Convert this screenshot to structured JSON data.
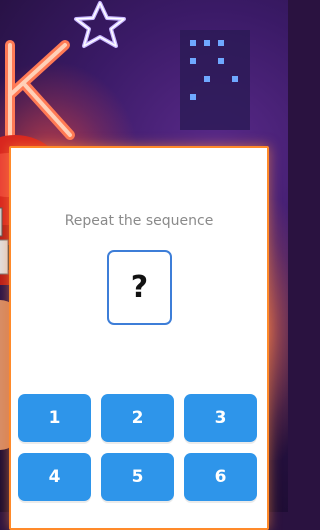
{
  "game": {
    "prompt": "Repeat the sequence",
    "sequence_display": "?",
    "keypad": [
      "1",
      "2",
      "3",
      "4",
      "5",
      "6"
    ]
  },
  "colors": {
    "accent": "#2e95ea",
    "card_border": "#ff8a2a",
    "sequence_border": "#3d7ed8"
  },
  "background": {
    "icons": [
      "neon-star-icon",
      "neon-letter-k",
      "boxing-glove"
    ]
  }
}
